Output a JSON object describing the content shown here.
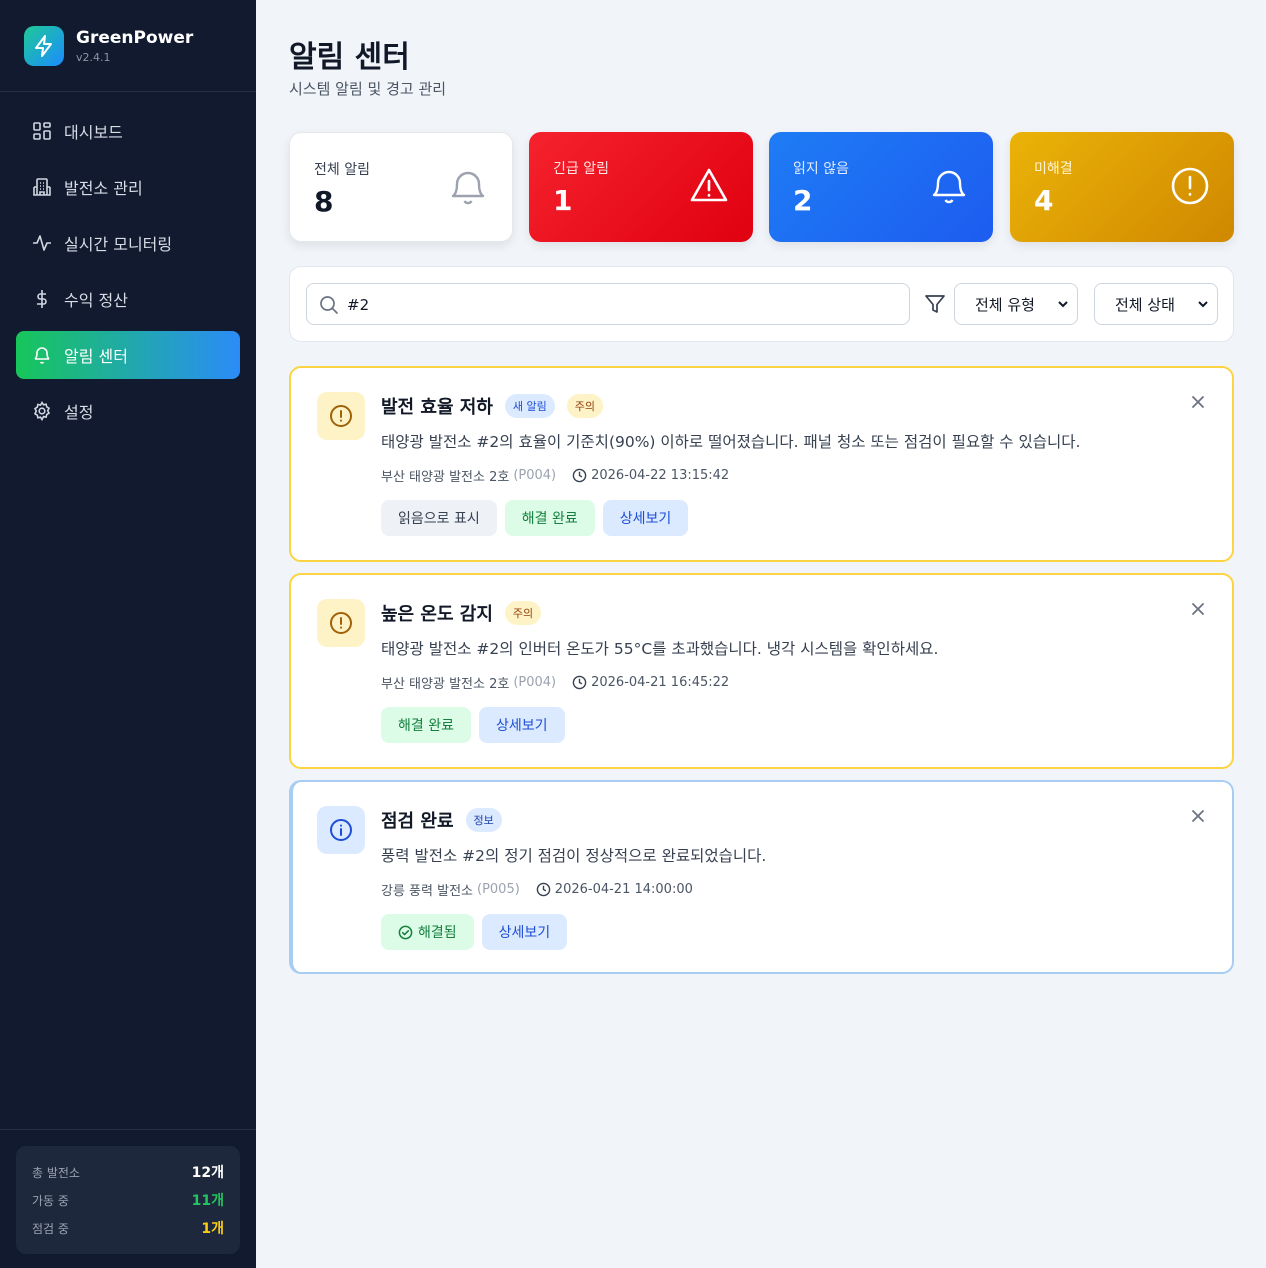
{
  "app": {
    "name": "GreenPower",
    "version": "v2.4.1"
  },
  "sidebar": {
    "items": [
      {
        "label": "대시보드",
        "icon": "grid-icon"
      },
      {
        "label": "발전소 관리",
        "icon": "building-icon"
      },
      {
        "label": "실시간 모니터링",
        "icon": "activity-icon"
      },
      {
        "label": "수익 정산",
        "icon": "dollar-icon"
      },
      {
        "label": "알림 센터",
        "icon": "bell-icon",
        "active": true
      },
      {
        "label": "설정",
        "icon": "gear-icon"
      }
    ],
    "stats": [
      {
        "label": "총 발전소",
        "value": "12개",
        "color": "#ffffff"
      },
      {
        "label": "가동 중",
        "value": "11개",
        "color": "#22c55e"
      },
      {
        "label": "점검 중",
        "value": "1개",
        "color": "#facc15"
      }
    ]
  },
  "header": {
    "title": "알림 센터",
    "subtitle": "시스템 알림 및 경고 관리"
  },
  "summary": [
    {
      "label": "전체 알림",
      "value": "8",
      "icon": "bell-icon"
    },
    {
      "label": "긴급 알림",
      "value": "1",
      "icon": "alert-triangle-icon"
    },
    {
      "label": "읽지 않음",
      "value": "2",
      "icon": "bell-icon"
    },
    {
      "label": "미해결",
      "value": "4",
      "icon": "alert-circle-icon"
    }
  ],
  "filters": {
    "search_value": "#2",
    "type_select": "전체 유형",
    "status_select": "전체 상태"
  },
  "alerts": [
    {
      "title": "발전 효율 저하",
      "badges": [
        "새 알림",
        "주의"
      ],
      "message": "태양광 발전소 #2의 효율이 기준치(90%) 이하로 떨어졌습니다. 패널 청소 또는 점검이 필요할 수 있습니다.",
      "plant": "부산 태양광 발전소 2호",
      "code": "(P004)",
      "time": "2026-04-22 13:15:42",
      "buttons": [
        "읽음으로 표시",
        "해결 완료",
        "상세보기"
      ]
    },
    {
      "title": "높은 온도 감지",
      "badges": [
        "주의"
      ],
      "message": "태양광 발전소 #2의 인버터 온도가 55°C를 초과했습니다. 냉각 시스템을 확인하세요.",
      "plant": "부산 태양광 발전소 2호",
      "code": "(P004)",
      "time": "2026-04-21 16:45:22",
      "buttons": [
        "해결 완료",
        "상세보기"
      ]
    },
    {
      "title": "점검 완료",
      "badges": [
        "정보"
      ],
      "message": "풍력 발전소 #2의 정기 점검이 정상적으로 완료되었습니다.",
      "plant": "강릉 풍력 발전소",
      "code": "(P005)",
      "time": "2026-04-21 14:00:00",
      "buttons": [
        "해결됨",
        "상세보기"
      ]
    }
  ]
}
